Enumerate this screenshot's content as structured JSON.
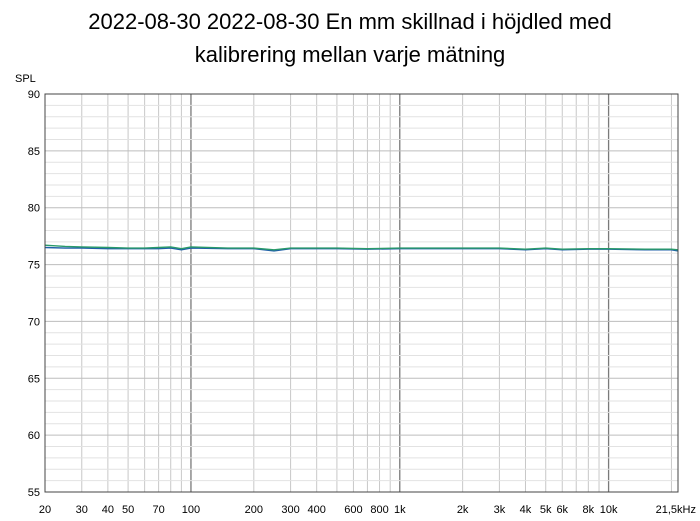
{
  "chart_data": {
    "type": "line",
    "title_lines": [
      "2022-08-30 2022-08-30 En mm skillnad i höjdled med",
      "kalibrering mellan varje mätning"
    ],
    "ylabel": "SPL",
    "xlabel": "",
    "x_scale": "log",
    "xlim": [
      20,
      21500
    ],
    "ylim": [
      55,
      90
    ],
    "grid": true,
    "y_ticks": [
      90,
      85,
      80,
      75,
      70,
      65,
      60,
      55
    ],
    "x_ticks": [
      {
        "value": 20,
        "label": "20"
      },
      {
        "value": 30,
        "label": "30"
      },
      {
        "value": 40,
        "label": "40"
      },
      {
        "value": 50,
        "label": "50"
      },
      {
        "value": 70,
        "label": "70"
      },
      {
        "value": 100,
        "label": "100"
      },
      {
        "value": 200,
        "label": "200"
      },
      {
        "value": 300,
        "label": "300"
      },
      {
        "value": 400,
        "label": "400"
      },
      {
        "value": 600,
        "label": "600"
      },
      {
        "value": 800,
        "label": "800"
      },
      {
        "value": 1000,
        "label": "1k"
      },
      {
        "value": 2000,
        "label": "2k"
      },
      {
        "value": 3000,
        "label": "3k"
      },
      {
        "value": 4000,
        "label": "4k"
      },
      {
        "value": 5000,
        "label": "5k"
      },
      {
        "value": 6000,
        "label": "6k"
      },
      {
        "value": 8000,
        "label": "8k"
      },
      {
        "value": 10000,
        "label": "10k"
      },
      {
        "value": 21500,
        "label": "21,5kHz"
      }
    ],
    "series": [
      {
        "color": "#1f5fa8",
        "x": [
          20,
          25,
          30,
          40,
          50,
          60,
          70,
          80,
          90,
          100,
          150,
          200,
          250,
          300,
          400,
          500,
          700,
          1000,
          1500,
          2000,
          3000,
          4000,
          5000,
          6000,
          8000,
          10000,
          15000,
          20000,
          21500
        ],
        "y": [
          76.5,
          76.45,
          76.45,
          76.4,
          76.4,
          76.4,
          76.4,
          76.45,
          76.3,
          76.45,
          76.4,
          76.4,
          76.2,
          76.4,
          76.4,
          76.4,
          76.35,
          76.4,
          76.4,
          76.4,
          76.4,
          76.3,
          76.4,
          76.3,
          76.35,
          76.35,
          76.3,
          76.3,
          76.2
        ]
      },
      {
        "color": "#2a9a6a",
        "x": [
          20,
          25,
          30,
          40,
          50,
          60,
          70,
          80,
          90,
          100,
          150,
          200,
          250,
          300,
          400,
          500,
          700,
          1000,
          1500,
          2000,
          3000,
          4000,
          5000,
          6000,
          8000,
          10000,
          15000,
          20000,
          21500
        ],
        "y": [
          76.7,
          76.6,
          76.55,
          76.5,
          76.45,
          76.45,
          76.5,
          76.55,
          76.4,
          76.55,
          76.45,
          76.45,
          76.3,
          76.45,
          76.45,
          76.45,
          76.4,
          76.45,
          76.45,
          76.45,
          76.45,
          76.35,
          76.45,
          76.35,
          76.4,
          76.4,
          76.35,
          76.35,
          76.3
        ]
      }
    ]
  }
}
